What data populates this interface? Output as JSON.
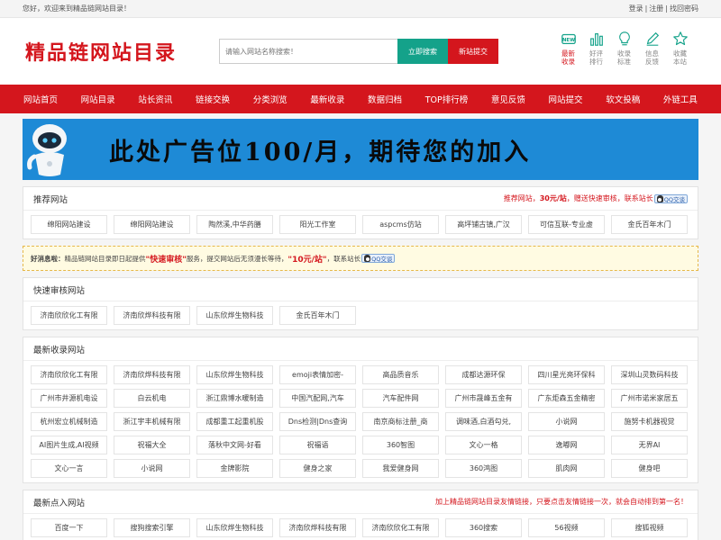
{
  "topbar": {
    "welcome": "您好，欢迎来到精品链网站目录！",
    "links": [
      "登录",
      "注册",
      "找回密码"
    ]
  },
  "header": {
    "logo": "精品链网站目录",
    "search_placeholder": "请输入网站名称搜索！",
    "search_button": "立即搜索",
    "submit_button": "新站提交",
    "quick_links": [
      {
        "line1": "最新",
        "line2": "收录",
        "icon": "new-icon",
        "active": true
      },
      {
        "line1": "好评",
        "line2": "排行",
        "icon": "chart-icon",
        "active": false
      },
      {
        "line1": "收录",
        "line2": "标准",
        "icon": "bulb-icon",
        "active": false
      },
      {
        "line1": "信息",
        "line2": "反馈",
        "icon": "pencil-icon",
        "active": false
      },
      {
        "line1": "收藏",
        "line2": "本站",
        "icon": "star-icon",
        "active": false
      }
    ]
  },
  "nav": [
    "网站首页",
    "网站目录",
    "站长资讯",
    "链接交换",
    "分类浏览",
    "最新收录",
    "数据归档",
    "TOP排行榜",
    "意见反馈",
    "网站提交",
    "软文投稿",
    "外链工具"
  ],
  "banner": {
    "text": "此处广告位100/月，期待您的加入"
  },
  "recommend": {
    "title": "推荐网站",
    "right_prefix": "推荐网站，",
    "right_price": "30元/站",
    "right_suffix": "，赠送快速审核，联系站长",
    "qq_label": "QQ交谈",
    "items": [
      "绵阳网站建设",
      "绵阳网站建设",
      "陶然溪,中华药膳",
      "阳光工作室",
      "aspcms仿站",
      "高坪铺古镇,广汉",
      "可信互联-专业虚",
      "金氏百年木门"
    ]
  },
  "notice": {
    "lead": "好消息啦：",
    "t1": "精品链网站目录即日起提供",
    "highlight1": "\"快速审核\"",
    "t2": "服务，提交网站后无须漫长等待，",
    "highlight2": "\"10元/站\"",
    "t3": "，联系站长",
    "qq_label": "QQ交谈"
  },
  "fast_review": {
    "title": "快速审核网站",
    "items": [
      "济南欣欣化工有限",
      "济南欣烨科技有限",
      "山东欣烨生物科技",
      "金氏百年木门"
    ]
  },
  "latest": {
    "title": "最新收录网站",
    "items": [
      "济南欣欣化工有限",
      "济南欣烨科技有限",
      "山东欣烨生物科技",
      "emoji表情加密-",
      "高品质音乐",
      "成都达源环保",
      "四川星光亮环保科",
      "深圳山灵数码科技",
      "广州市井源机电设",
      "白云机电",
      "浙江鼎博水暖制造",
      "中国汽配网,汽车",
      "汽车配件网",
      "广州市晟峰五金有",
      "广东炬森五金精密",
      "广州市诺米家居五",
      "杭州宏立机械制造",
      "浙江宇丰机械有限",
      "成都重工起重机股",
      "Dns检测|Dns查询",
      "南京商标注册_商",
      "调味酒,白酒勾兑,",
      "小说网",
      "施努卡机器视觉",
      "AI图片生成,AI视频",
      "祝福大全",
      "落秋中文网-好看",
      "祝福语",
      "360智图",
      "文心一格",
      "逸嘟网",
      "无界AI",
      "文心一言",
      "小说网",
      "金牌影院",
      "健身之家",
      "我爱健身网",
      "360鸿图",
      "肌肉网",
      "健身吧"
    ]
  },
  "clicks": {
    "title": "最新点入网站",
    "right": "加上精品链网站目录友情链接，只要点击友情链接一次，就会自动排到第一名！",
    "items": [
      "百度一下",
      "搜狗搜索引擎",
      "山东欣烨生物科技",
      "济南欣烨科技有限",
      "济南欣欣化工有限",
      "360搜索",
      "56视频",
      "搜狐视频"
    ]
  }
}
